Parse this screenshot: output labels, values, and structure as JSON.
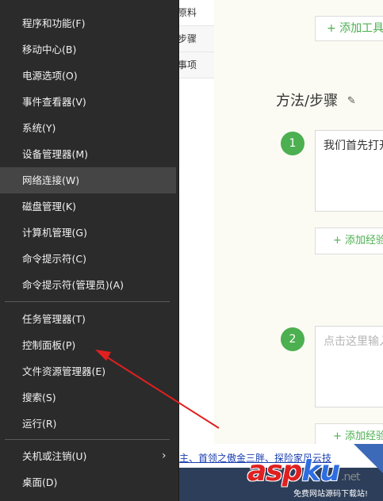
{
  "menu": {
    "items": [
      {
        "label": "程序和功能(F)"
      },
      {
        "label": "移动中心(B)"
      },
      {
        "label": "电源选项(O)"
      },
      {
        "label": "事件查看器(V)"
      },
      {
        "label": "系统(Y)"
      },
      {
        "label": "设备管理器(M)"
      },
      {
        "label": "网络连接(W)"
      },
      {
        "label": "磁盘管理(K)"
      },
      {
        "label": "计算机管理(G)"
      },
      {
        "label": "命令提示符(C)"
      },
      {
        "label": "命令提示符(管理员)(A)"
      },
      {
        "label": "任务管理器(T)"
      },
      {
        "label": "控制面板(P)"
      },
      {
        "label": "文件资源管理器(E)"
      },
      {
        "label": "搜索(S)"
      },
      {
        "label": "运行(R)"
      },
      {
        "label": "关机或注销(U)"
      },
      {
        "label": "桌面(D)"
      }
    ],
    "highlighted_index": 6,
    "submenu_icon": "chevron-right-icon"
  },
  "background": {
    "left_tabs": [
      "原料",
      "步骤",
      "事项"
    ],
    "add_tool_label": "+ 添加工具",
    "section_title": "方法/步骤",
    "steps": [
      {
        "number": "1",
        "text": "我们首先打开"
      },
      {
        "number": "2",
        "placeholder": "点击这里输入"
      }
    ],
    "add_experience_label": "+ 添加经验",
    "news_text": "主、首领之傲金三胖、探险家风云技"
  },
  "colors": {
    "menu_bg": "#2b2b2b",
    "menu_highlight": "#454545",
    "accent_green": "#4caf50",
    "arrow_red": "#e02020"
  }
}
